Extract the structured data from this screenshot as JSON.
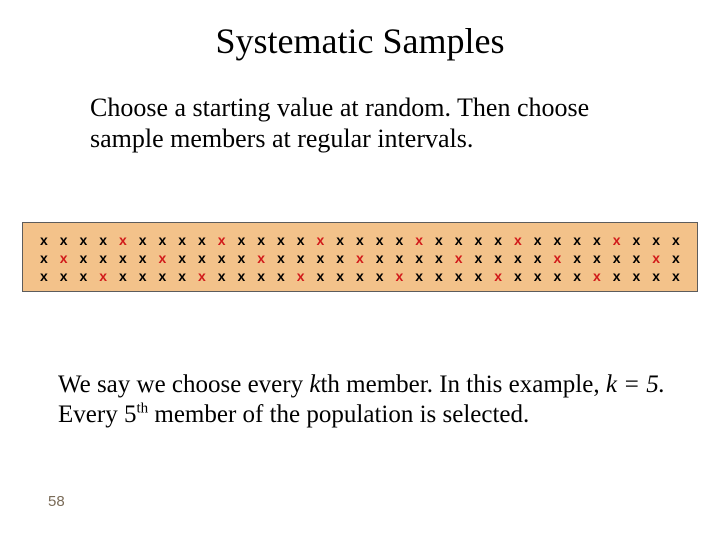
{
  "title": "Systematic Samples",
  "intro": "Choose a starting value at random. Then choose sample members at regular intervals.",
  "diagram": {
    "glyph": "x",
    "rows": 3,
    "cols": 33,
    "k": 5,
    "start_index": 4,
    "highlight_color": "#d11a1a",
    "normal_color": "#000000",
    "background": "#f3c28a"
  },
  "conclusion": {
    "pre": "We say we choose every ",
    "kth": "k",
    "kth_suffix": "th member. In this example, ",
    "k_equals": "k = 5.",
    "tail_pre": "  Every 5",
    "tail_sup": "th",
    "tail_post": " member of the population is selected."
  },
  "page_number": "58"
}
